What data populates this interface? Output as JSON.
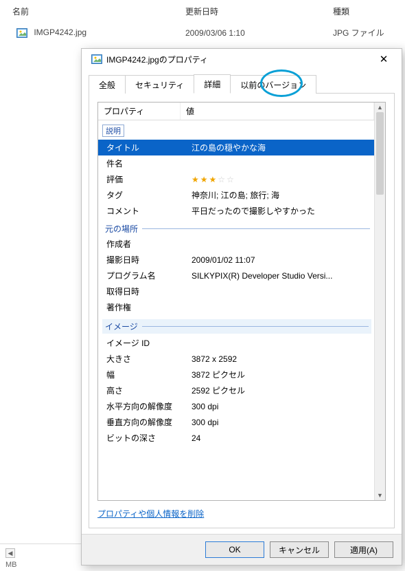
{
  "explorer": {
    "headers": {
      "name": "名前",
      "date": "更新日時",
      "type": "種類"
    },
    "row": {
      "filename": "IMGP4242.jpg",
      "modified": "2009/03/06 1:10",
      "filetype": "JPG ファイル"
    },
    "status": {
      "size_suffix": "MB"
    }
  },
  "dialog": {
    "title": "IMGP4242.jpgのプロパティ",
    "tabs": {
      "general": "全般",
      "security": "セキュリティ",
      "details": "詳細",
      "previous": "以前のバージョン"
    },
    "columns": {
      "property": "プロパティ",
      "value": "値"
    },
    "sections": {
      "description": "説明",
      "origin": "元の場所",
      "image": "イメージ"
    },
    "properties": {
      "title": {
        "label": "タイトル",
        "value": "江の島の穏やかな海"
      },
      "subject": {
        "label": "件名",
        "value": ""
      },
      "rating": {
        "label": "評価",
        "stars": 3,
        "max": 5
      },
      "tags": {
        "label": "タグ",
        "value": "神奈川; 江の島; 旅行; 海"
      },
      "comment": {
        "label": "コメント",
        "value": "平日だったので撮影しやすかった"
      },
      "author": {
        "label": "作成者",
        "value": ""
      },
      "date_taken": {
        "label": "撮影日時",
        "value": "2009/01/02 11:07"
      },
      "program": {
        "label": "プログラム名",
        "value": "SILKYPIX(R) Developer Studio Versi..."
      },
      "acquired": {
        "label": "取得日時",
        "value": ""
      },
      "copyright": {
        "label": "著作権",
        "value": ""
      },
      "image_id": {
        "label": "イメージ ID",
        "value": ""
      },
      "dimensions": {
        "label": "大きさ",
        "value": "3872 x 2592"
      },
      "width": {
        "label": "幅",
        "value": "3872 ピクセル"
      },
      "height": {
        "label": "高さ",
        "value": "2592 ピクセル"
      },
      "hres": {
        "label": "水平方向の解像度",
        "value": "300 dpi"
      },
      "vres": {
        "label": "垂直方向の解像度",
        "value": "300 dpi"
      },
      "bitdepth": {
        "label": "ビットの深さ",
        "value": "24"
      }
    },
    "remove_link": "プロパティや個人情報を削除",
    "buttons": {
      "ok": "OK",
      "cancel": "キャンセル",
      "apply": "適用(A)"
    }
  }
}
